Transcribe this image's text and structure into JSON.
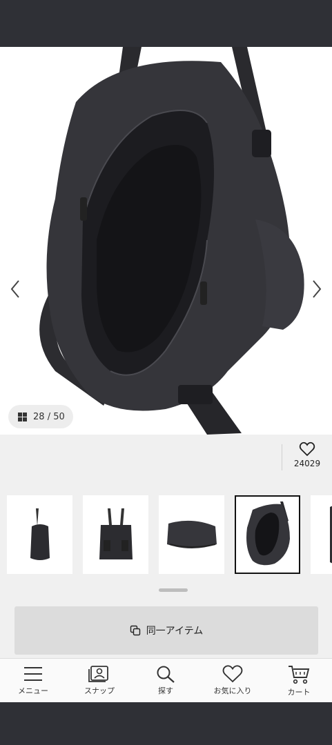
{
  "gallery": {
    "current": "28",
    "total": "50",
    "counter_separator": "/",
    "image_subject": "black-nylon-tote-backpack-open-top-view"
  },
  "favorites": {
    "count": "24029"
  },
  "thumbnails": [
    {
      "subject": "tote-bag-side-view",
      "selected": false
    },
    {
      "subject": "tote-bag-front-view",
      "selected": false
    },
    {
      "subject": "tote-bag-bottom-view",
      "selected": false
    },
    {
      "subject": "tote-bag-open-top-view",
      "selected": true
    },
    {
      "subject": "tote-bag-detail-view",
      "selected": false
    }
  ],
  "same_item_button": {
    "label": "同一アイテム",
    "icon": "copy-icon"
  },
  "tabbar": {
    "items": [
      {
        "label": "メニュー",
        "icon": "menu-icon"
      },
      {
        "label": "スナップ",
        "icon": "snap-icon"
      },
      {
        "label": "探す",
        "icon": "search-icon"
      },
      {
        "label": "お気に入り",
        "icon": "heart-icon"
      },
      {
        "label": "カート",
        "icon": "cart-icon"
      }
    ]
  },
  "colors": {
    "status_bar": "#2f3036",
    "page_background": "#f0f0f0",
    "button_background": "#dcdcdc",
    "tabbar_background": "#fafafa"
  }
}
